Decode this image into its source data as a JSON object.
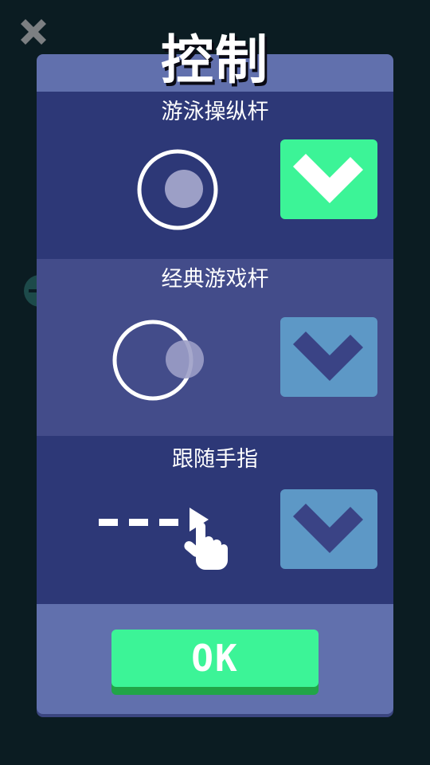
{
  "dialog": {
    "title": "控制",
    "confirm_label": "OK"
  },
  "options": [
    {
      "label": "游泳操纵杆",
      "selected": true,
      "icon": "swim-joystick-icon"
    },
    {
      "label": "经典游戏杆",
      "selected": false,
      "icon": "classic-joystick-icon"
    },
    {
      "label": "跟随手指",
      "selected": false,
      "icon": "follow-finger-icon"
    }
  ],
  "close": {
    "icon": "close-icon"
  },
  "colors": {
    "background": "#0b1c22",
    "panel": "#6170ad",
    "row_dark": "#2d3877",
    "row_mid": "#434c8a",
    "selected": "#3cf497",
    "unselected": "#5d98c6",
    "check_mark_unselected": "#3a4385"
  }
}
